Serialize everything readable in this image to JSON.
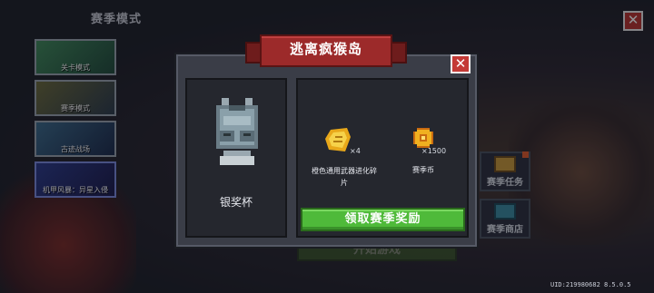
{
  "header": {
    "title": "赛季模式",
    "close_icon": "close-icon"
  },
  "modes": [
    {
      "label": "关卡模式"
    },
    {
      "label": "赛季模式"
    },
    {
      "label": "古迹战场"
    },
    {
      "label": "机甲风暴：异星入侵"
    }
  ],
  "side_menu": [
    {
      "label": "赛季任务",
      "icon": "scroll-icon"
    },
    {
      "label": "赛季商店",
      "icon": "shop-icon"
    }
  ],
  "start_button": {
    "label": "开始游戏"
  },
  "footer": {
    "uid": "UID:219980682 8.5.0.5"
  },
  "dialog": {
    "title": "逃离疯猴岛",
    "trophy": {
      "name": "银奖杯",
      "icon": "silver-trophy-icon"
    },
    "rewards": [
      {
        "name": "橙色通用武器进化碎片",
        "quantity": "×4",
        "icon": "weapon-fragment-icon"
      },
      {
        "name": "赛季币",
        "quantity": "×1500",
        "icon": "season-coin-icon"
      }
    ],
    "claim_button": {
      "label": "领取赛季奖励"
    }
  },
  "colors": {
    "accent_green": "#4fba3a",
    "ribbon_red": "#9c2a2a",
    "close_red": "#c43a36"
  }
}
